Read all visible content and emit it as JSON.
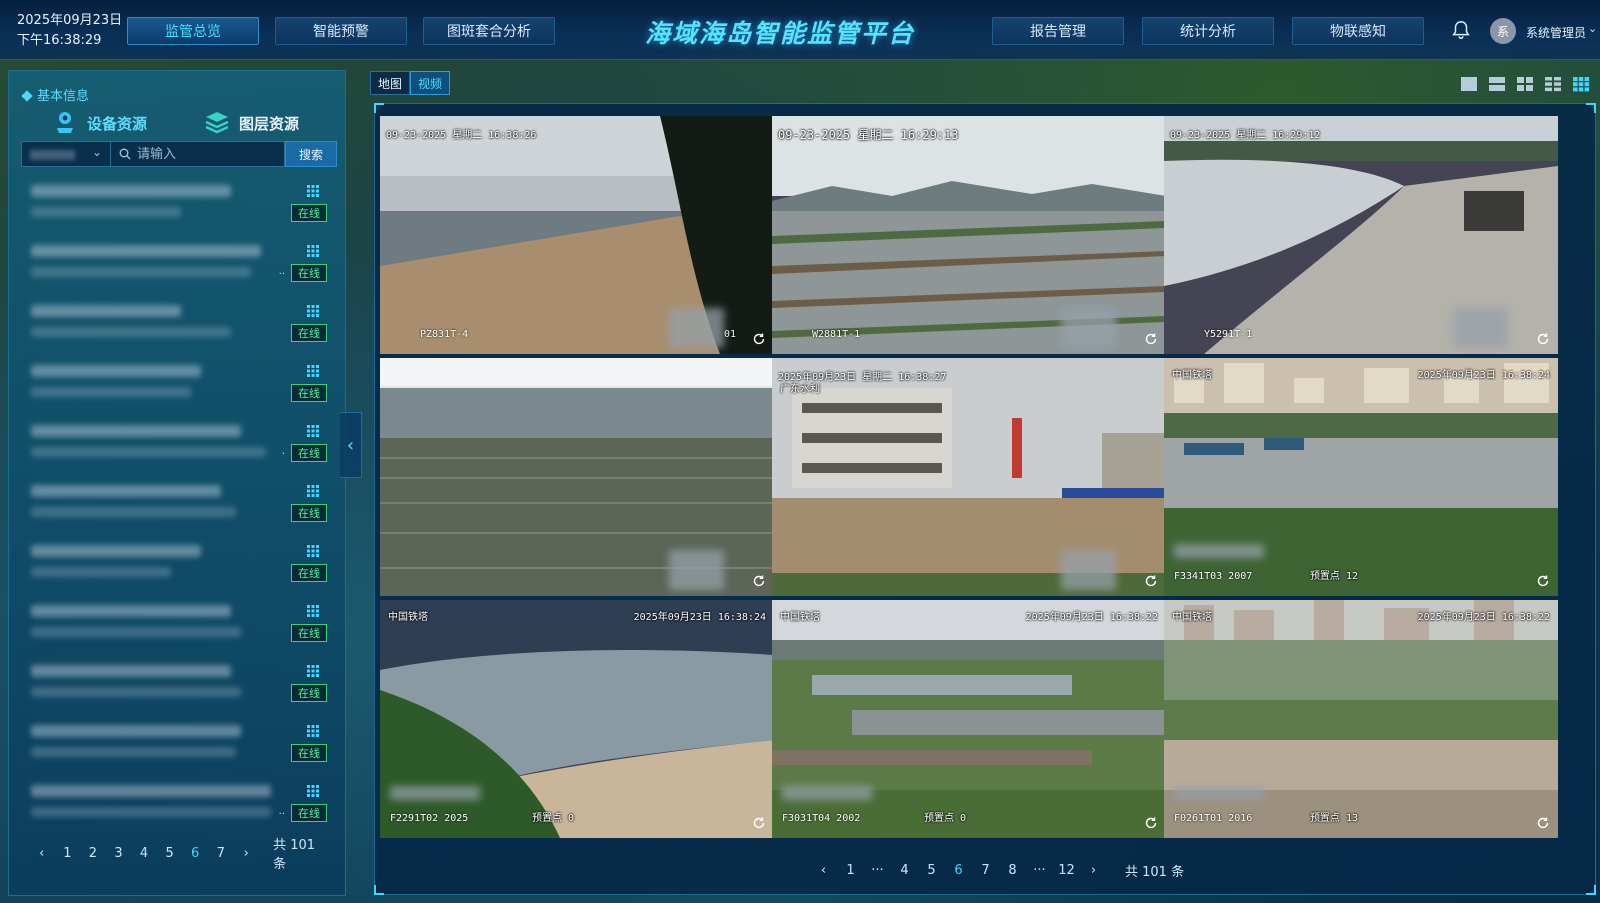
{
  "header": {
    "date": "2025年09月23日",
    "time": "下午16:38:29",
    "title": "海域海岛智能监管平台",
    "nav_left": [
      "监管总览",
      "智能预警",
      "图斑套合分析"
    ],
    "nav_right": [
      "报告管理",
      "统计分析",
      "物联感知"
    ],
    "active_nav": "监管总览",
    "avatar_text": "系",
    "user_name": "系统管理员"
  },
  "left_panel": {
    "section_title": "基本信息",
    "tabs": [
      "设备资源",
      "图层资源"
    ],
    "active_tab": "设备资源",
    "search_placeholder": "请输入",
    "search_button": "搜索",
    "devices": [
      {
        "status": "在线",
        "dots": ""
      },
      {
        "status": "在线",
        "dots": "··"
      },
      {
        "status": "在线",
        "dots": ""
      },
      {
        "status": "在线",
        "dots": ""
      },
      {
        "status": "在线",
        "dots": "·"
      },
      {
        "status": "在线",
        "dots": ""
      },
      {
        "status": "在线",
        "dots": ""
      },
      {
        "status": "在线",
        "dots": ""
      },
      {
        "status": "在线",
        "dots": ""
      },
      {
        "status": "在线",
        "dots": ""
      },
      {
        "status": "在线",
        "dots": "··"
      }
    ],
    "pager": {
      "prev": "‹",
      "pages": [
        "1",
        "2",
        "3",
        "4",
        "5",
        "6",
        "7"
      ],
      "active": "6",
      "next": "›",
      "total": "共 101 条"
    }
  },
  "view_toggle": {
    "map": "地图",
    "video": "视频"
  },
  "video_cells": [
    {
      "ts": "09-23-2025 星期二 16:38:26",
      "cam": "PZ831T-4",
      "extra": "01"
    },
    {
      "ts": "09-23-2025 星期二 16:29:13",
      "cam": "W2881T-1",
      "extra": ""
    },
    {
      "ts": "09-23-2025 星期二 16:29:12",
      "cam": "Y5291T-1",
      "extra": ""
    },
    {
      "ts": "",
      "cam": "",
      "extra": ""
    },
    {
      "ts": "2025年09月23日 星期二 16:38:27",
      "sub": "广东水利",
      "cam": "",
      "extra": ""
    },
    {
      "ts": "2025年09月23日 16:38:24",
      "sub": "中国铁塔",
      "cam": "F3341T03  2007",
      "extra": "预置点 12"
    },
    {
      "ts": "2025年09月23日 16:38:24",
      "sub": "中国铁塔",
      "cam": "F2291T02  2025",
      "extra": "预置点 0"
    },
    {
      "ts": "2025年09月23日 16:38:22",
      "sub": "中国铁塔",
      "cam": "F3031T04  2002",
      "extra": "预置点 0"
    },
    {
      "ts": "2025年09月23日 16:38:22",
      "sub": "中国铁塔",
      "cam": "F0261T01  2016",
      "extra": "预置点 13"
    }
  ],
  "video_pager": {
    "prev": "‹",
    "pages": [
      "1",
      "···",
      "4",
      "5",
      "6",
      "7",
      "8",
      "···",
      "12"
    ],
    "active": "6",
    "next": "›",
    "total": "共 101 条"
  },
  "icons": {
    "bell": "bell-icon",
    "device_tab": "camera-device-icon",
    "layer_tab": "layers-icon",
    "search": "search-icon",
    "grid": "grid-icon",
    "refresh": "refresh-icon",
    "collapse": "chevron-left-icon"
  },
  "colors": {
    "accent": "#3fd6ff",
    "online": "#5df09a",
    "header_bg": "#0a2f57"
  }
}
